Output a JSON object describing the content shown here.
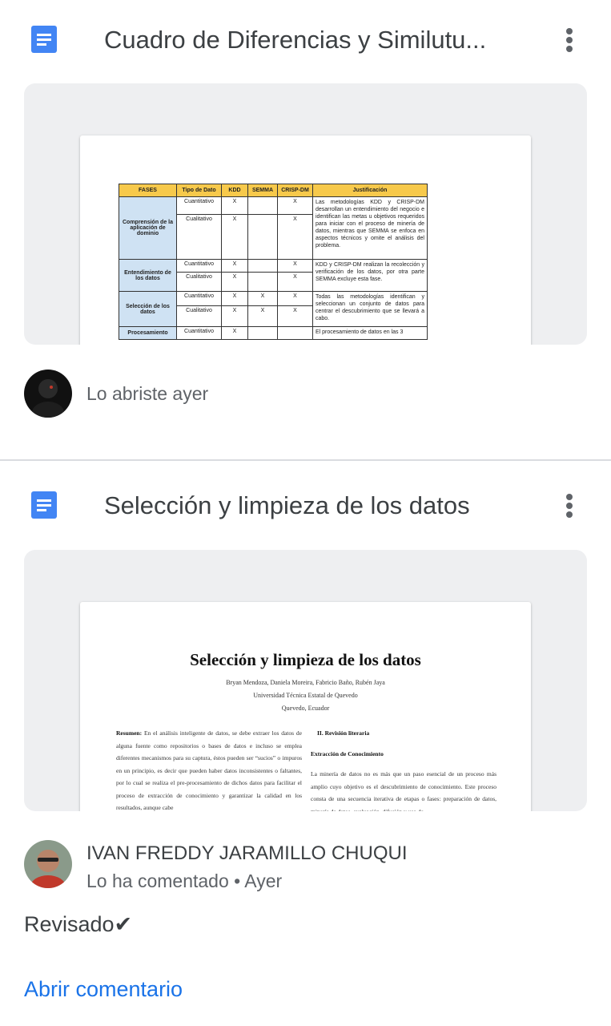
{
  "cards": [
    {
      "title": "Cuadro de Diferencias y Similutu...",
      "icon": "google-docs-icon",
      "activity": "Lo abriste ayer",
      "preview": {
        "headers": [
          "FASES",
          "Tipo de Dato",
          "KDD",
          "SEMMA",
          "CRISP-DM",
          "Justificación"
        ],
        "rows": [
          {
            "phase": "Comprensión de la aplicación de dominio",
            "types": [
              "Cuantitativo",
              "Cualitativo"
            ],
            "kdd": [
              "X",
              "X"
            ],
            "semma": [
              "",
              ""
            ],
            "crisp": [
              "X",
              "X"
            ],
            "just": "Las metodologías KDD y CRISP-DM desarrollan un entendimiento del negocio e identifican las metas u objetivos requeridos para iniciar con el proceso de minería de datos, mientras que SEMMA se enfoca en aspectos técnicos y omite el análisis del problema."
          },
          {
            "phase": "Entendimiento de los datos",
            "types": [
              "Cuantitativo",
              "Cualitativo"
            ],
            "kdd": [
              "X",
              "X"
            ],
            "semma": [
              "",
              ""
            ],
            "crisp": [
              "X",
              "X"
            ],
            "just": "KDD y CRISP-DM realizan la recolección y verificación de los datos, por otra parte SEMMA excluye esta fase."
          },
          {
            "phase": "Selección de los datos",
            "types": [
              "Cuantitativo",
              "Cualitativo"
            ],
            "kdd": [
              "X",
              "X"
            ],
            "semma": [
              "X",
              "X"
            ],
            "crisp": [
              "X",
              "X"
            ],
            "just": "Todas las metodologías identifican y seleccionan un conjunto de datos para centrar el descubrimiento que se llevará a cabo."
          },
          {
            "phase": "Procesamiento",
            "types": [
              "Cuantitativo"
            ],
            "kdd": [
              "X"
            ],
            "semma": [
              ""
            ],
            "crisp": [
              ""
            ],
            "just": "El procesamiento de datos en las 3"
          }
        ]
      }
    },
    {
      "title": "Selección y limpieza de los datos",
      "icon": "google-docs-icon",
      "author": "IVAN FREDDY JARAMILLO CHUQUI",
      "activity": "Lo ha comentado • Ayer",
      "comment": "Revisado✔",
      "open_comment_label": "Abrir comentario",
      "preview": {
        "paper_title": "Selección y limpieza de los datos",
        "authors": "Bryan Mendoza, Daniela Moreira, Fabricio Baño, Rubén Jaya",
        "university": "Universidad Técnica Estatal de Quevedo",
        "location": "Quevedo, Ecuador",
        "left_col_label": "Resumen:",
        "left_col": "En el análisis inteligente de datos, se debe extraer los datos de alguna fuente como repositorios o bases de datos e incluso se emplea diferentes mecanismos para su captura, éstos pueden ser “sucios” o impuros en un principio, es decir que pueden haber datos inconsistentes o faltantes, por lo cual se realiza el pre-procesamiento de dichos datos para facilitar el proceso de extracción de conocimiento y garantizar la calidad en los resultados, aunque cabe",
        "section": "II.    Revisión literaria",
        "subsection": "Extracción de Conocimiento",
        "right_col": "La minería de datos no es más que un paso esencial de un proceso más amplio cuyo objetivo es el descubrimiento de conocimiento. Este proceso consta de una secuencia iterativa de etapas o fases: preparación de datos, minería de datos, evaluación, difusión y uso de"
      }
    }
  ],
  "colors": {
    "docs_blue": "#4285f4",
    "link_blue": "#1a73e8",
    "preview_bg": "#eeeff1",
    "table_header": "#f7c94b",
    "table_phase": "#cfe2f3"
  }
}
